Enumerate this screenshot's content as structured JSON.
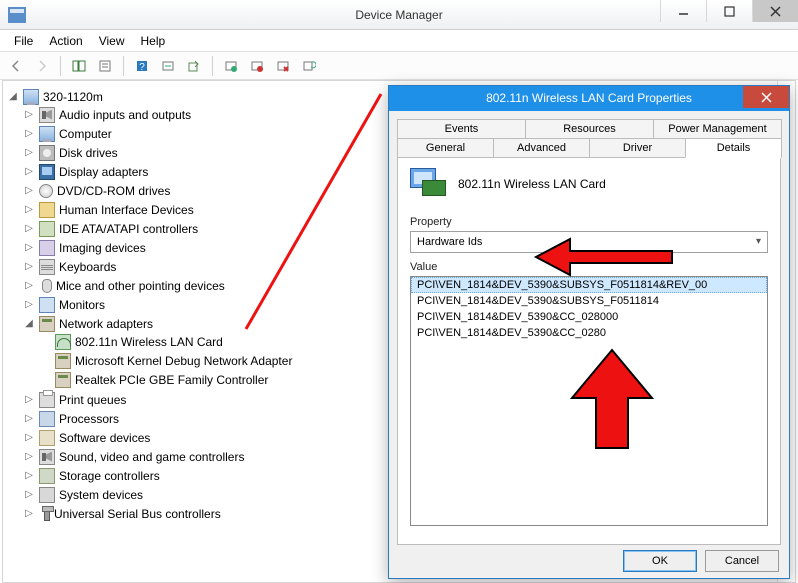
{
  "window": {
    "title": "Device Manager",
    "menu": [
      "File",
      "Action",
      "View",
      "Help"
    ]
  },
  "tree": {
    "root": "320-1120m",
    "items": [
      {
        "label": "Audio inputs and outputs",
        "icon": "ic-audio"
      },
      {
        "label": "Computer",
        "icon": "ic-computer"
      },
      {
        "label": "Disk drives",
        "icon": "ic-disk"
      },
      {
        "label": "Display adapters",
        "icon": "ic-display"
      },
      {
        "label": "DVD/CD-ROM drives",
        "icon": "ic-dvd"
      },
      {
        "label": "Human Interface Devices",
        "icon": "ic-hid"
      },
      {
        "label": "IDE ATA/ATAPI controllers",
        "icon": "ic-ide"
      },
      {
        "label": "Imaging devices",
        "icon": "ic-image"
      },
      {
        "label": "Keyboards",
        "icon": "ic-kbd"
      },
      {
        "label": "Mice and other pointing devices",
        "icon": "ic-mouse"
      },
      {
        "label": "Monitors",
        "icon": "ic-monitor"
      },
      {
        "label": "Network adapters",
        "icon": "ic-net",
        "expanded": true,
        "children": [
          {
            "label": "802.11n Wireless LAN Card",
            "icon": "ic-wifi"
          },
          {
            "label": "Microsoft Kernel Debug Network Adapter",
            "icon": "ic-net"
          },
          {
            "label": "Realtek PCIe GBE Family Controller",
            "icon": "ic-net"
          }
        ]
      },
      {
        "label": "Print queues",
        "icon": "ic-print"
      },
      {
        "label": "Processors",
        "icon": "ic-cpu"
      },
      {
        "label": "Software devices",
        "icon": "ic-soft"
      },
      {
        "label": "Sound, video and game controllers",
        "icon": "ic-audio"
      },
      {
        "label": "Storage controllers",
        "icon": "ic-storage"
      },
      {
        "label": "System devices",
        "icon": "ic-sys"
      },
      {
        "label": "Universal Serial Bus controllers",
        "icon": "ic-usb"
      }
    ]
  },
  "dialog": {
    "title": "802.11n Wireless LAN Card Properties",
    "tabs_row1": [
      "Events",
      "Resources",
      "Power Management"
    ],
    "tabs_row2": [
      "General",
      "Advanced",
      "Driver",
      "Details"
    ],
    "active_tab": "Details",
    "device_name": "802.11n Wireless LAN Card",
    "property_label": "Property",
    "property_value": "Hardware Ids",
    "value_label": "Value",
    "values": [
      "PCI\\VEN_1814&DEV_5390&SUBSYS_F0511814&REV_00",
      "PCI\\VEN_1814&DEV_5390&SUBSYS_F0511814",
      "PCI\\VEN_1814&DEV_5390&CC_028000",
      "PCI\\VEN_1814&DEV_5390&CC_0280"
    ],
    "buttons": {
      "ok": "OK",
      "cancel": "Cancel"
    }
  }
}
